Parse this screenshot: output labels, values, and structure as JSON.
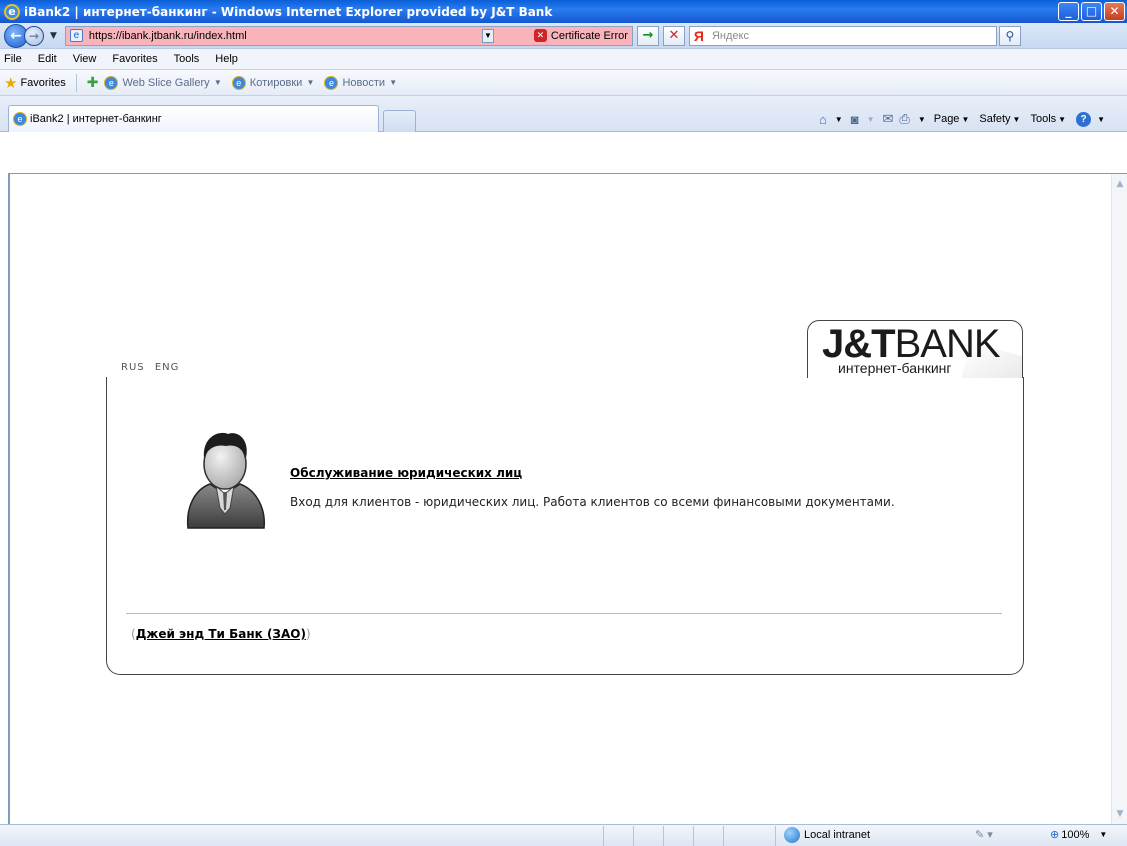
{
  "window": {
    "title": "iBank2 | интернет-банкинг - Windows Internet Explorer provided by J&T Bank",
    "controls": [
      "_",
      "□",
      "✕"
    ]
  },
  "address_bar": {
    "url": "https://ibank.jtbank.ru/index.html",
    "cert_error": "Certificate Error",
    "search_placeholder": "Яндекс",
    "search_logo": "Я"
  },
  "menu": {
    "items": [
      "File",
      "Edit",
      "View",
      "Favorites",
      "Tools",
      "Help"
    ]
  },
  "favorites_bar": {
    "favorites_label": "Favorites",
    "items": [
      "Web Slice Gallery",
      "Котировки",
      "Новости"
    ]
  },
  "tabs": {
    "active_title": "iBank2 | интернет-банкинг"
  },
  "command_bar": {
    "page": "Page",
    "safety": "Safety",
    "tools": "Tools"
  },
  "page": {
    "lang": [
      "RUS",
      "ENG"
    ],
    "logo_main": "J&T",
    "logo_bank": "BANK",
    "logo_sub": "интернет-банкинг",
    "service_title": "Обслуживание юридических лиц",
    "service_desc": "Вход для клиентов - юридических лиц. Работа клиентов со всеми финансовыми документами.",
    "footer_open": "(",
    "footer_link": "Джей энд Ти Банк (ЗАО)",
    "footer_close": ")"
  },
  "status_bar": {
    "zone": "Local intranet",
    "zoom": "100%"
  },
  "colors": {
    "url_error_bg": "#f8b4ba",
    "titlebar": "#1556d0"
  }
}
